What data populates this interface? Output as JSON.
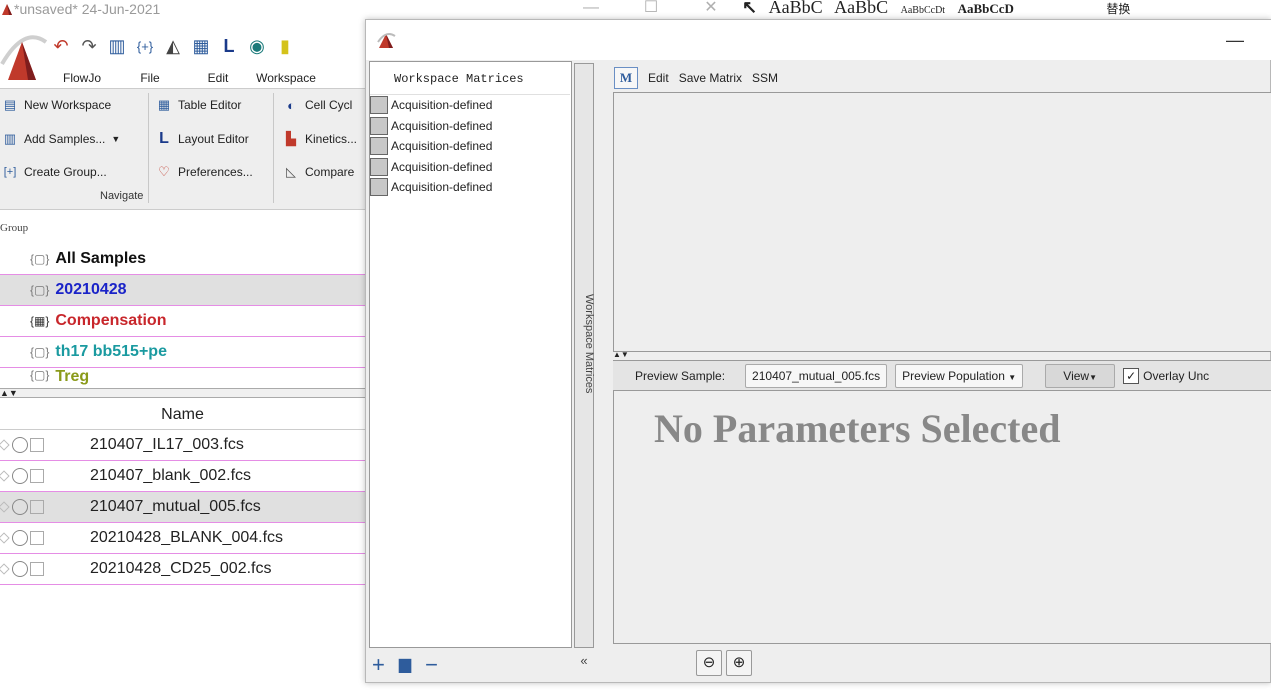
{
  "bg_window": {
    "title": "*unsaved* 24-Jun-2021",
    "word_styles": [
      "AaBbC",
      "AaBbC",
      "AaBbCcDt",
      "AaBbCcD"
    ],
    "word_cn": "替换",
    "tabs": [
      "FlowJo",
      "File",
      "Edit",
      "Workspace"
    ],
    "ribbon": {
      "col1": [
        "New Workspace",
        "Add Samples...",
        "Create Group..."
      ],
      "col2": [
        "Table Editor",
        "Layout Editor",
        "Preferences..."
      ],
      "col3": [
        "Cell Cycl",
        "Kinetics...",
        "Compare"
      ],
      "navigate_label": "Navigate"
    },
    "group_header": "Group",
    "groups": [
      {
        "label": "All Samples",
        "color": "#111111"
      },
      {
        "label": "20210428",
        "color": "#1a23c8"
      },
      {
        "label": "Compensation",
        "color": "#c8262b"
      },
      {
        "label": "th17 bb515+pe",
        "color": "#1a9aa0"
      },
      {
        "label": "Treg",
        "color": "#8a9a1a"
      }
    ],
    "name_header": "Name",
    "samples": [
      "210407_IL17_003.fcs",
      "210407_blank_002.fcs",
      "210407_mutual_005.fcs",
      "20210428_BLANK_004.fcs",
      "20210428_CD25_002.fcs"
    ],
    "accent_colors": {
      "row_border": "#e58de5",
      "selected_bg": "#e0e0e0"
    }
  },
  "dialog": {
    "matrices_title": "Workspace Matrices",
    "matrices": [
      "Acquisition-defined",
      "Acquisition-defined",
      "Acquisition-defined",
      "Acquisition-defined",
      "Acquisition-defined"
    ],
    "vertical_tab_label": "Workspace Matrices",
    "collapse_label": "«",
    "toolbar": {
      "m_icon": "M",
      "edit": "Edit",
      "save_matrix": "Save Matrix",
      "ssm": "SSM"
    },
    "preview": {
      "sample_label": "Preview Sample:",
      "sample_value": "210407_mutual_005.fcs",
      "population_label": "Preview Population",
      "view_label": "View",
      "overlay_label": "Overlay Unc"
    },
    "no_params_text": "No Parameters Selected"
  }
}
